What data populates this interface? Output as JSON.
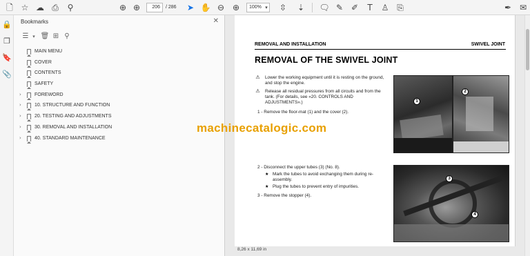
{
  "toolbar": {
    "page_current": "206",
    "page_total": "/ 286",
    "zoom": "100%"
  },
  "bookmarks_panel": {
    "title": "Bookmarks",
    "items": [
      {
        "label": "MAIN MENU",
        "expandable": false
      },
      {
        "label": "COVER",
        "expandable": false
      },
      {
        "label": "CONTENTS",
        "expandable": false
      },
      {
        "label": "SAFETY",
        "expandable": false
      },
      {
        "label": "FOREWORD",
        "expandable": true
      },
      {
        "label": "10. STRUCTURE AND FUNCTION",
        "expandable": true
      },
      {
        "label": "20. TESTING AND ADJUSTMENTS",
        "expandable": true
      },
      {
        "label": "30. REMOVAL AND INSTALLATION",
        "expandable": true
      },
      {
        "label": "40. STANDARD MAINTENANCE",
        "expandable": true
      }
    ]
  },
  "document": {
    "header_left": "REMOVAL AND INSTALLATION",
    "header_right": "SWIVEL JOINT",
    "title": "REMOVAL OF THE SWIVEL JOINT",
    "warning_1": "Lower the working equipment until it is resting on the ground, and stop the engine.",
    "warning_2": "Release all residual pressures from all circuits and from the tank. (For details, see «20. CONTROLS AND ADJUSTMENTS».)",
    "step_1": "1 - Remove the floor-mat (1) and the cover (2).",
    "step_2": "2 - Disconnect the upper tubes (3) (No. 8).",
    "note_1": "Mark the tubes to avoid exchanging them during re-assembly.",
    "note_2": "Plug the tubes to prevent entry of impurities.",
    "step_3": "3 - Remove the stopper (4).",
    "callouts": [
      "1",
      "2",
      "3",
      "4"
    ]
  },
  "watermark": "machinecatalogic.com",
  "page_size": "8,26 x 11,69 in",
  "colors": {
    "accent": "#1473e6",
    "watermark": "#e8a000"
  }
}
